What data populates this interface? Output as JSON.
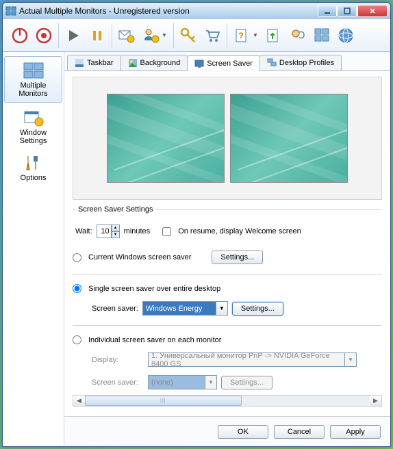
{
  "window": {
    "title": "Actual Multiple Monitors - Unregistered version"
  },
  "sidebar": {
    "items": [
      {
        "label": "Multiple Monitors"
      },
      {
        "label": "Window Settings"
      },
      {
        "label": "Options"
      }
    ]
  },
  "tabs": [
    {
      "label": "Taskbar"
    },
    {
      "label": "Background"
    },
    {
      "label": "Screen Saver"
    },
    {
      "label": "Desktop Profiles"
    }
  ],
  "active_tab": 2,
  "screensaver": {
    "legend": "Screen Saver Settings",
    "wait_label": "Wait:",
    "wait_value": "10",
    "wait_unit": "minutes",
    "onresume_label": "On resume, display Welcome screen",
    "onresume_checked": false,
    "mode_current_label": "Current Windows screen saver",
    "mode_single_label": "Single screen saver over entire desktop",
    "mode_individual_label": "Individual screen saver on each monitor",
    "selected_mode": "single",
    "settings_btn": "Settings...",
    "saver_label": "Screen saver:",
    "saver_selected": "Windows Energy",
    "display_label": "Display:",
    "display_value": "1. Универсальный монитор PnP -> NVIDIA GeForce 8400 GS",
    "disabled_saver_value": "(none)"
  },
  "footer": {
    "ok": "OK",
    "cancel": "Cancel",
    "apply": "Apply"
  }
}
